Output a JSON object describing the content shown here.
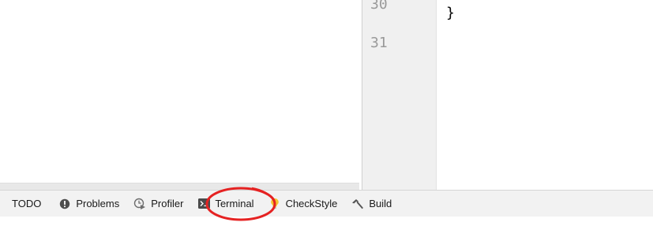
{
  "editor": {
    "line_numbers": [
      "30",
      "31"
    ],
    "code_lines": [
      "}"
    ]
  },
  "tool_window_bar": {
    "tabs": [
      {
        "label": "TODO",
        "icon": "none"
      },
      {
        "label": "Problems",
        "icon": "problems-icon"
      },
      {
        "label": "Profiler",
        "icon": "profiler-icon"
      },
      {
        "label": "Terminal",
        "icon": "terminal-icon"
      },
      {
        "label": "CheckStyle",
        "icon": "checkstyle-bulb-icon"
      },
      {
        "label": "Build",
        "icon": "build-hammer-icon"
      }
    ]
  },
  "annotation": {
    "highlight_target": "Terminal",
    "highlight_color": "#e52222"
  }
}
